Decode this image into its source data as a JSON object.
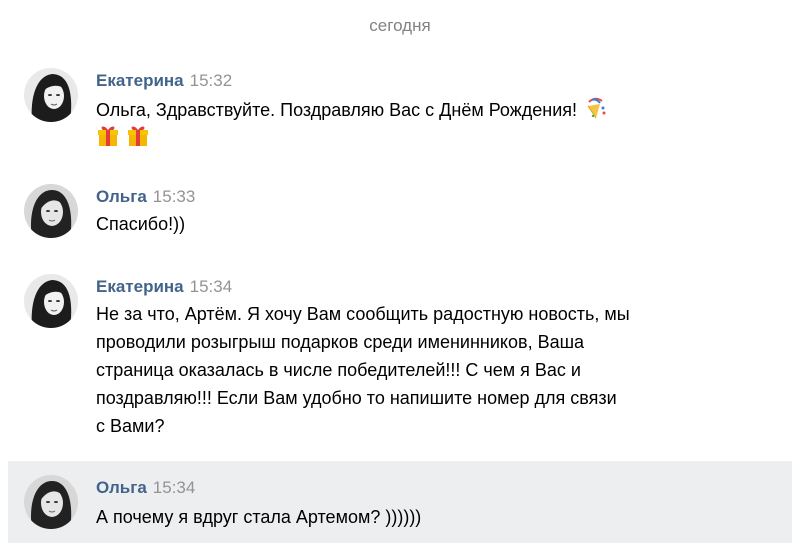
{
  "date_separator": "сегодня",
  "messages": [
    {
      "author": "Екатерина",
      "time": "15:32",
      "text": "Ольга, Здравствуйте. Поздравляю Вас с Днём Рождения!"
    },
    {
      "author": "Ольга",
      "time": "15:33",
      "text": "Спасибо!))"
    },
    {
      "author": "Екатерина",
      "time": "15:34",
      "lines": [
        "Не за что, Артём. Я хочу Вам сообщить радостную новость, мы",
        "проводили розыгрыш подарков среди именинников, Ваша",
        "страница оказалась в числе победителей!!! С чем я Вас и",
        "поздравляю!!! Если Вам удобно то напишите номер для связи",
        "с Вами?"
      ]
    },
    {
      "author": "Ольга",
      "time": "15:34",
      "text": "А почему я вдруг стала Артемом? ))))))"
    }
  ],
  "icons": {
    "party": "party-popper-icon",
    "gift": "gift-icon"
  },
  "colors": {
    "author": "#42648b",
    "time": "#939393",
    "date": "#828282",
    "highlight": "#edeef0"
  }
}
